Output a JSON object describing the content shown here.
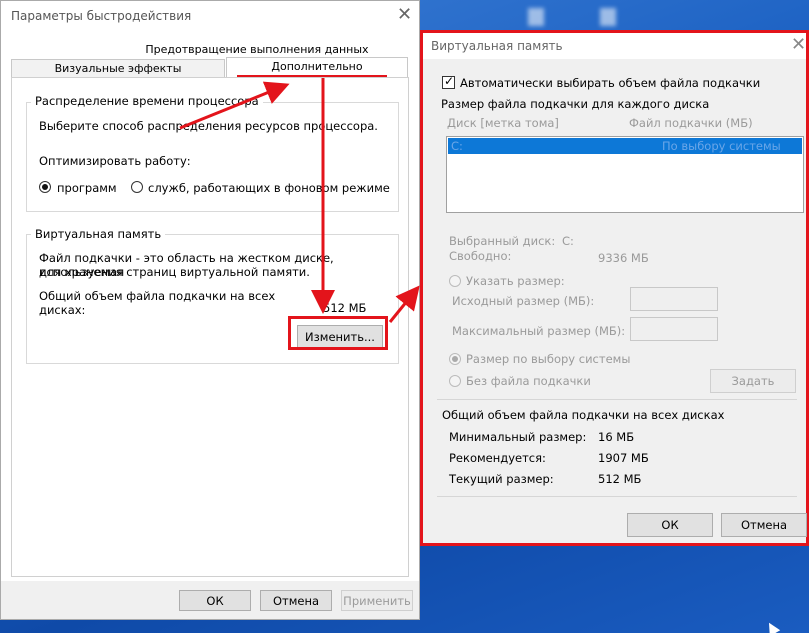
{
  "main_window": {
    "title": "Параметры быстродействия",
    "tabs": {
      "data_execution": "Предотвращение выполнения данных",
      "visual_effects": "Визуальные эффекты",
      "advanced": "Дополнительно"
    },
    "cpu_group": {
      "title": "Распределение времени процессора",
      "description": "Выберите способ распределения ресурсов процессора.",
      "optimize_label": "Оптимизировать работу:",
      "option_programs": "программ",
      "option_services": "служб, работающих в фоновом режиме",
      "selected": "programs"
    },
    "vm_group": {
      "title": "Виртуальная память",
      "description_line1": "Файл подкачки - это область на жестком диске, используемая",
      "description_line2": "для хранения страниц виртуальной памяти.",
      "total_label_line1": "Общий объем файла подкачки на всех",
      "total_label_line2": "дисках:",
      "total_value": "512 МБ",
      "change_button": "Изменить..."
    },
    "footer": {
      "ok": "ОК",
      "cancel": "Отмена",
      "apply": "Применить"
    }
  },
  "vm_dialog": {
    "title": "Виртуальная память",
    "auto_manage_label": "Автоматически выбирать объем файла подкачки",
    "auto_manage_checked": true,
    "per_drive_group_title": "Размер файла подкачки для каждого диска",
    "columns": {
      "drive": "Диск [метка тома]",
      "paging_file": "Файл подкачки (МБ)"
    },
    "drives": [
      {
        "drive": "C:",
        "size": "По выбору системы"
      }
    ],
    "selected_drive_label": "Выбранный диск:",
    "selected_drive_value": "C:",
    "free_label": "Свободно:",
    "free_value": "9336 МБ",
    "custom_size_label": "Указать размер:",
    "initial_size_label": "Исходный размер (МБ):",
    "max_size_label": "Максимальный размер (МБ):",
    "system_managed_label": "Размер по выбору системы",
    "no_paging_label": "Без файла подкачки",
    "set_button": "Задать",
    "totals_group_title": "Общий объем файла подкачки на всех дисках",
    "min_label": "Минимальный размер:",
    "min_value": "16 МБ",
    "recommended_label": "Рекомендуется:",
    "recommended_value": "1907 МБ",
    "current_label": "Текущий размер:",
    "current_value": "512 МБ",
    "ok": "ОК",
    "cancel": "Отмена"
  },
  "colors": {
    "annotation_red": "#e3141b",
    "selection_blue": "#0d78d7",
    "desktop_blue": "#1e63c4"
  },
  "icons": {
    "close": "close-icon",
    "check": "checkmark-icon",
    "cursor": "mouse-cursor-icon"
  }
}
